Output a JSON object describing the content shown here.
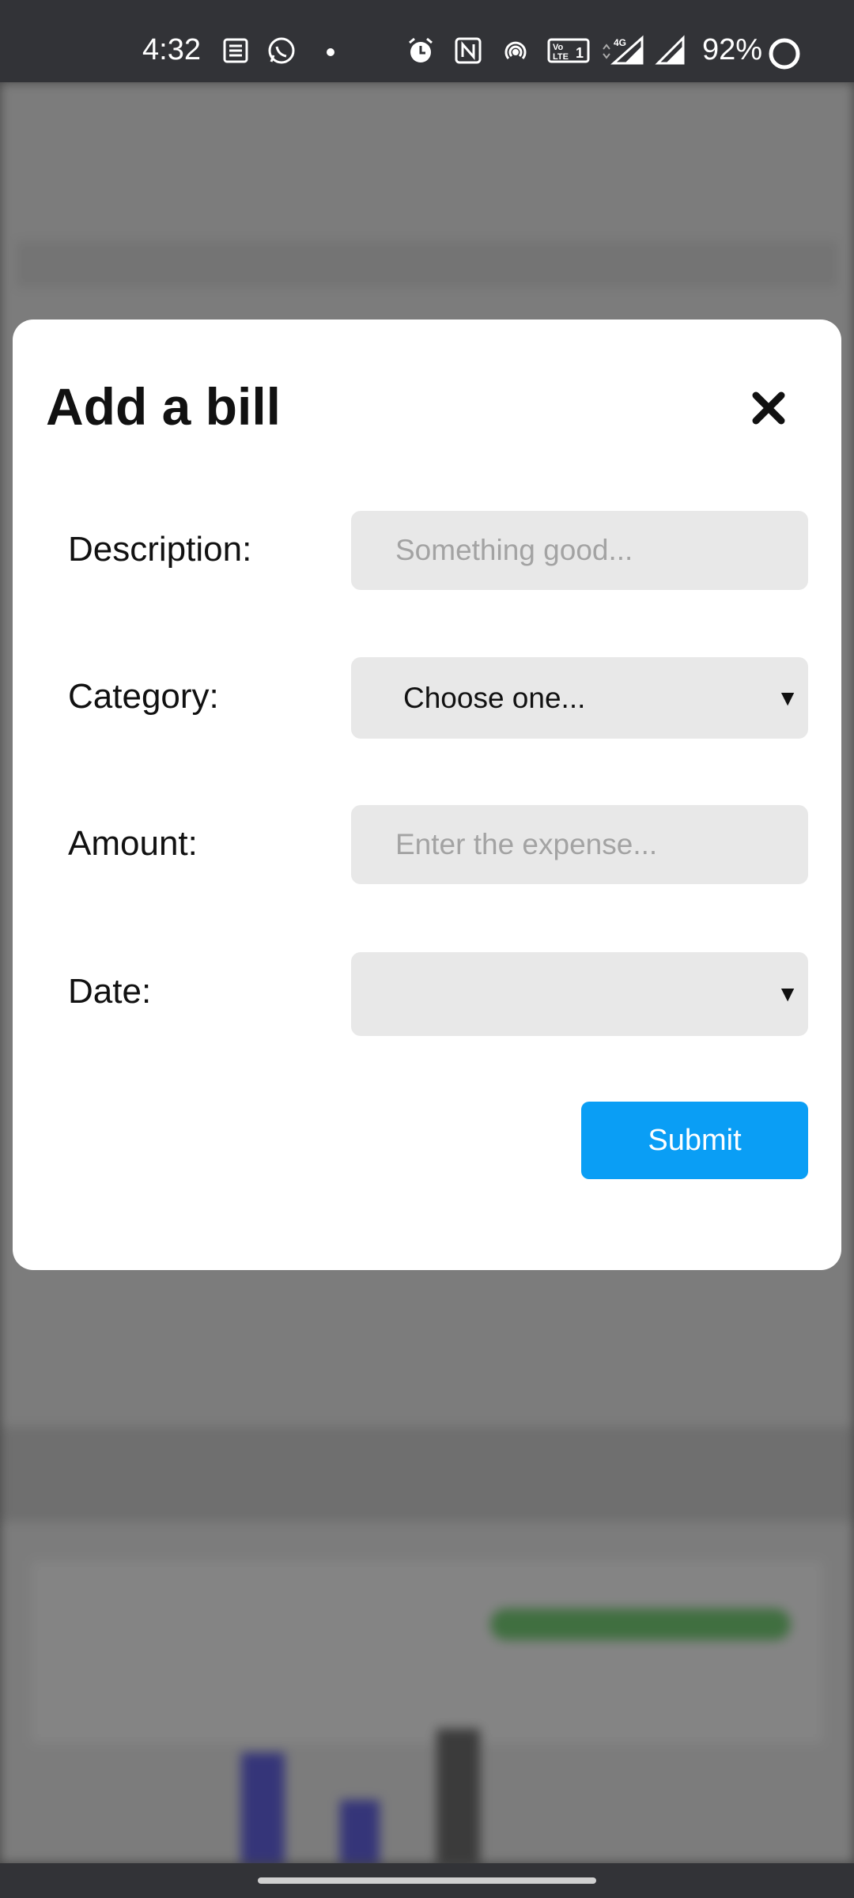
{
  "status_bar": {
    "time": "4:32",
    "battery": "92%",
    "icons": [
      "news-icon",
      "whatsapp-icon",
      "dot-icon",
      "alarm-icon",
      "nfc-icon",
      "hotspot-icon",
      "volte-icon",
      "signal-4g-icon",
      "signal-icon",
      "battery-ring-icon"
    ]
  },
  "modal": {
    "title": "Add a bill",
    "close_icon": "close-icon",
    "fields": [
      {
        "label": "Description:",
        "placeholder": "Something good..."
      },
      {
        "label": "Category:",
        "value": "Choose one..."
      },
      {
        "label": "Amount:",
        "placeholder": "Enter the expense..."
      },
      {
        "label": "Date:",
        "value": ""
      }
    ],
    "submit_label": "Submit"
  },
  "colors": {
    "submit": "#0a9ef5",
    "field_bg": "#e8e8e8",
    "status_bar": "#323337"
  }
}
